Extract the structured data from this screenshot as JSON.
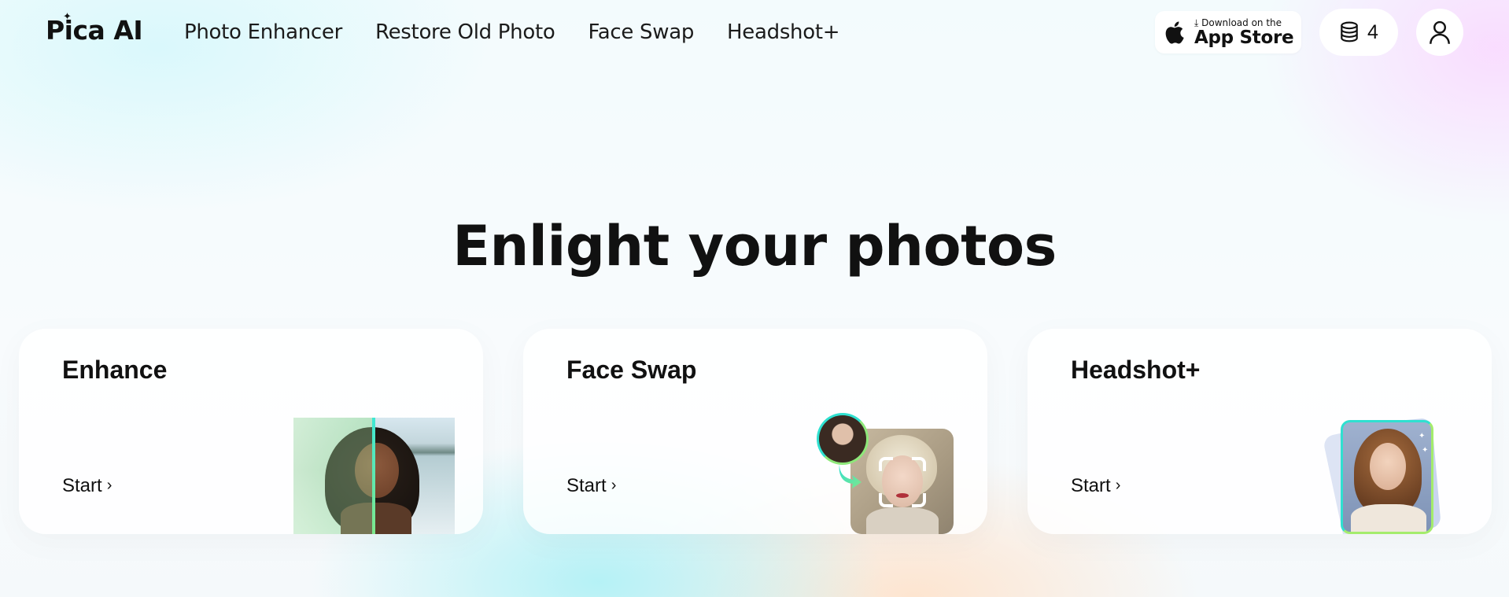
{
  "header": {
    "logo_text": "Pica AI",
    "nav": [
      {
        "label": "Photo Enhancer"
      },
      {
        "label": "Restore Old Photo"
      },
      {
        "label": "Face Swap"
      },
      {
        "label": "Headshot+"
      }
    ],
    "app_store": {
      "small_text": "Download on the",
      "big_text": "App Store"
    },
    "credits": {
      "count": "4",
      "icon": "coins-stack-icon"
    },
    "account_icon": "user-icon"
  },
  "hero": {
    "title": "Enlight your photos"
  },
  "cards": [
    {
      "title": "Enhance",
      "start_label": "Start"
    },
    {
      "title": "Face Swap",
      "start_label": "Start"
    },
    {
      "title": "Headshot+",
      "start_label": "Start"
    }
  ],
  "colors": {
    "accent_cyan": "#2fe0d0",
    "accent_green": "#8ee87a",
    "text": "#111111",
    "card_bg": "#ffffff"
  }
}
